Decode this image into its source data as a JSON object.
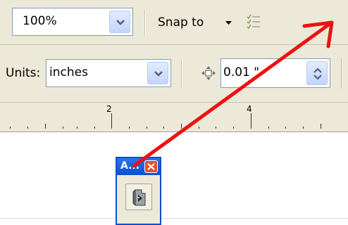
{
  "toolbar": {
    "zoom_value": "100%",
    "snap_to_label": "Snap to",
    "units_label": "Units:",
    "units_value": "inches",
    "nudge_value": "0.01 \""
  },
  "ruler": {
    "labels": [
      "2",
      "4"
    ]
  },
  "mini_toolbox": {
    "title": "A..."
  },
  "colors": {
    "arrow": "#ee1111",
    "toolbar_bg": "#ece9d8",
    "title_bar": "#0a4fd5",
    "close_button": "#e0512b"
  },
  "icons": [
    "chevron-down-icon",
    "snap-options-icon",
    "nudge-arrows-icon",
    "spin-icon",
    "close-icon",
    "tool-icon"
  ]
}
